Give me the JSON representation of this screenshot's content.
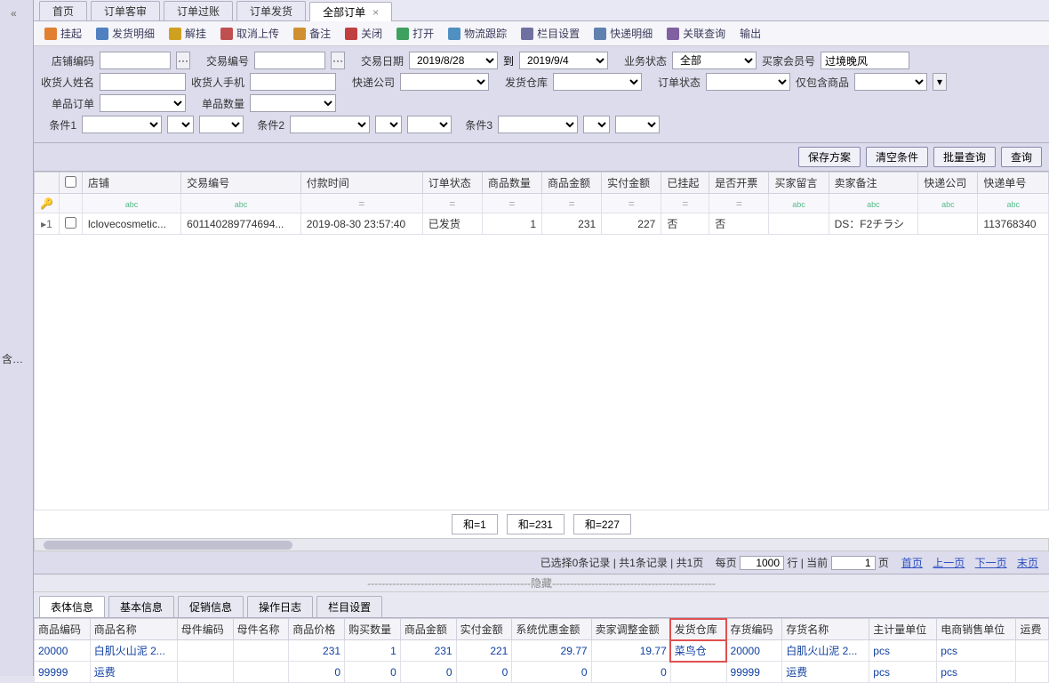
{
  "left_gutter": {
    "text": "含…",
    "chev": "«"
  },
  "tabs": {
    "items": [
      "首页",
      "订单客审",
      "订单过账",
      "订单发货",
      "全部订单"
    ],
    "active": 4,
    "close": "×"
  },
  "toolbar": {
    "items": [
      "挂起",
      "发货明细",
      "解挂",
      "取消上传",
      "备注",
      "关闭",
      "打开",
      "物流跟踪",
      "栏目设置",
      "快递明细",
      "关联查询",
      "输出"
    ]
  },
  "filters": {
    "r1": {
      "shop_code_label": "店铺编码",
      "shop_code": "",
      "trade_no_label": "交易编号",
      "trade_no": "",
      "trade_date_label": "交易日期",
      "date_from": "2019/8/28",
      "to": "到",
      "date_to": "2019/9/4",
      "biz_status_label": "业务状态",
      "biz_status": "全部",
      "buyer_id_label": "买家会员号",
      "buyer_id": "过境晚风"
    },
    "r2": {
      "recv_name_label": "收货人姓名",
      "recv_name": "",
      "recv_phone_label": "收货人手机",
      "recv_phone": "",
      "express_co_label": "快递公司",
      "express_co": "",
      "ship_wh_label": "发货仓库",
      "ship_wh": "",
      "order_status_label": "订单状态",
      "order_status": "",
      "only_goods_label": "仅包含商品",
      "only_goods": ""
    },
    "r3": {
      "single_order_label": "单品订单",
      "single_order": "",
      "single_qty_label": "单品数量",
      "single_qty": ""
    },
    "r4": {
      "c1": "条件1",
      "c2": "条件2",
      "c3": "条件3",
      "eq": "="
    }
  },
  "actions": {
    "save": "保存方案",
    "clear": "清空条件",
    "batch": "批量查询",
    "query": "查询"
  },
  "grid": {
    "cols": [
      "",
      "",
      "店铺",
      "交易编号",
      "付款时间",
      "订单状态",
      "商品数量",
      "商品金额",
      "实付金额",
      "已挂起",
      "是否开票",
      "买家留言",
      "卖家备注",
      "快递公司",
      "快递单号"
    ],
    "filter_placeholder_eq": "=",
    "filter_placeholder_abc": "abc",
    "key_icon": "🔑",
    "row": {
      "mark": "▸1",
      "shop": "lclovecosmetic...",
      "trade_no": "601140289774694...",
      "pay_time": "2019-08-30 23:57:40",
      "status": "已发货",
      "qty": "1",
      "amount": "231",
      "paid": "227",
      "hang": "否",
      "invoice": "否",
      "buyer_msg": "",
      "seller_note": "DS：F2チラシ",
      "express_co": "",
      "express_no": "113768340"
    }
  },
  "summary": {
    "s1": "和=1",
    "s2": "和=231",
    "s3": "和=227"
  },
  "status": {
    "sel": "已选择0条记录",
    "sep": " | ",
    "total": "共1条记录",
    "pages": "共1页",
    "per_label1": "每页",
    "per_val": "1000",
    "per_label2": "行",
    "sep2": " | ",
    "cur": "当前",
    "cur_val": "1",
    "cur_label2": "页",
    "first": "首页",
    "prev": "上一页",
    "next": "下一页",
    "last": "末页"
  },
  "hidebar": "----------------------------------------------隐藏----------------------------------------------",
  "dtabs": {
    "items": [
      "表体信息",
      "基本信息",
      "促销信息",
      "操作日志",
      "栏目设置"
    ],
    "active": 0
  },
  "dgrid": {
    "cols": [
      "商品编码",
      "商品名称",
      "母件编码",
      "母件名称",
      "商品价格",
      "购买数量",
      "商品金额",
      "实付金额",
      "系统优惠金额",
      "卖家调整金额",
      "发货仓库",
      "存货编码",
      "存货名称",
      "主计量单位",
      "电商销售单位",
      "运费"
    ],
    "rows": [
      {
        "code": "20000",
        "name": "白肌火山泥 2...",
        "pcode": "",
        "pname": "",
        "price": "231",
        "qty": "1",
        "amount": "231",
        "paid": "221",
        "sysdisc": "29.77",
        "selleradj": "19.77",
        "wh": "菜鸟仓",
        "invcode": "20000",
        "invname": "白肌火山泥 2...",
        "unit": "pcs",
        "eunit": "pcs"
      },
      {
        "code": "99999",
        "name": "运费",
        "pcode": "",
        "pname": "",
        "price": "0",
        "qty": "0",
        "amount": "0",
        "paid": "0",
        "sysdisc": "0",
        "selleradj": "0",
        "wh": "",
        "invcode": "99999",
        "invname": "运费",
        "unit": "pcs",
        "eunit": "pcs"
      }
    ]
  }
}
